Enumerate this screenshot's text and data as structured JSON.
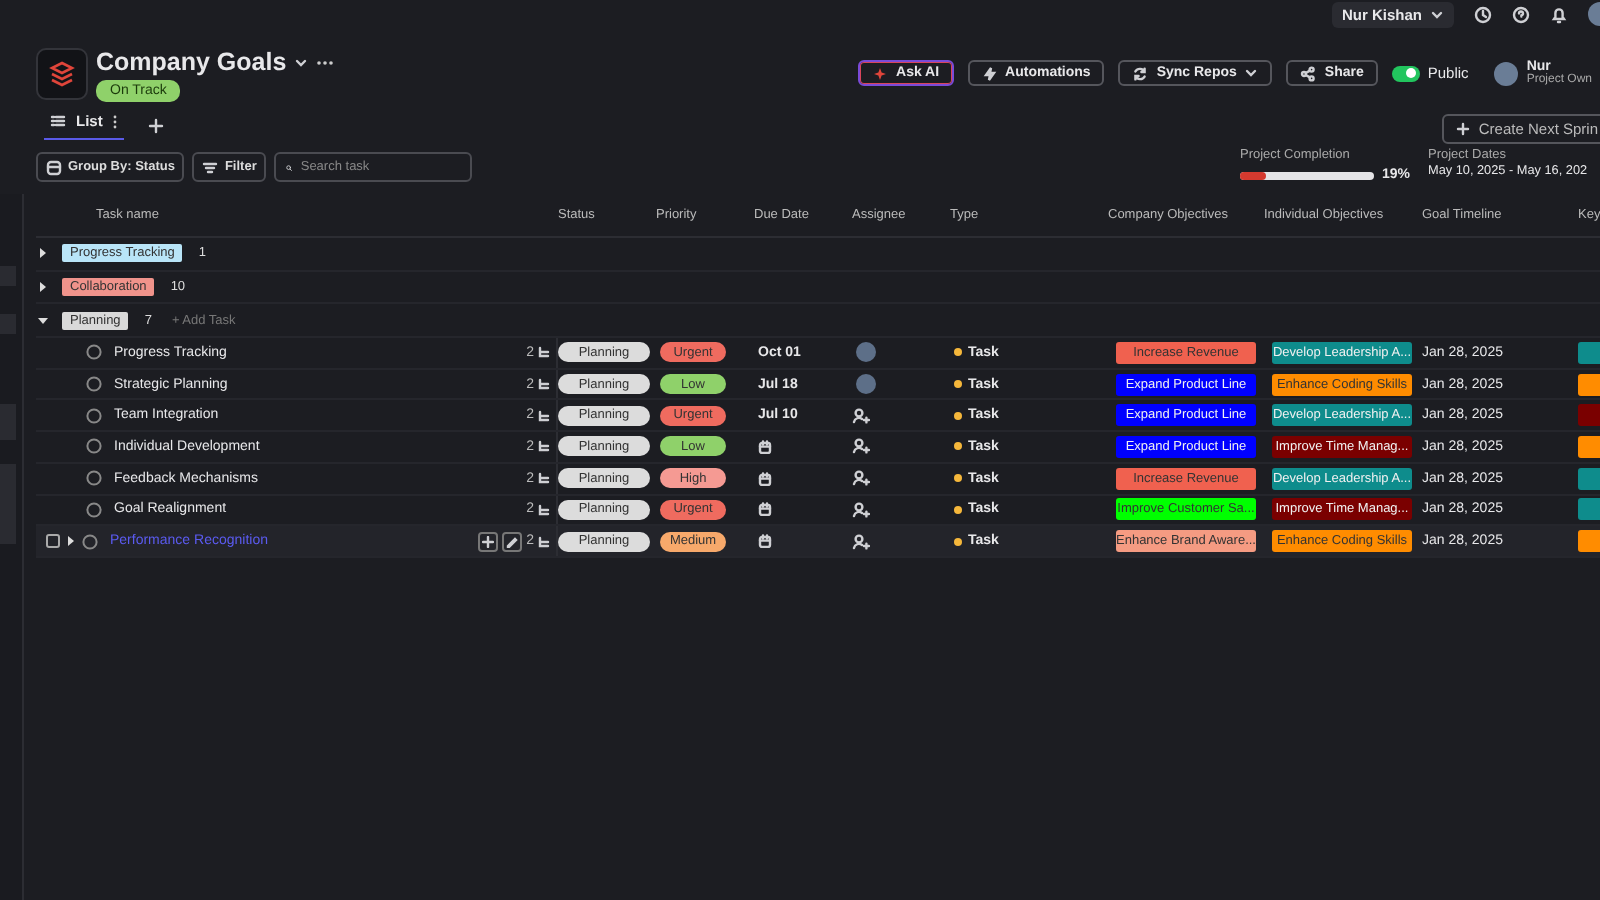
{
  "top_bar": {
    "user": "Nur Kishan"
  },
  "project": {
    "title": "Company Goals",
    "status": "On Track"
  },
  "actions": [
    {
      "kind": "ai",
      "label": "Ask AI"
    },
    {
      "kind": "bolt",
      "label": "Automations"
    },
    {
      "kind": "sync",
      "label": "Sync Repos"
    },
    {
      "kind": "share",
      "label": "Share"
    }
  ],
  "visibility": {
    "label": "Public",
    "on": true
  },
  "owner": {
    "name": "Nur",
    "role": "Project Own"
  },
  "tabs": [
    {
      "label": "List",
      "selected": true
    }
  ],
  "create_button": "Create Next Sprin",
  "toolbar": {
    "group_by": "Group By: Status",
    "filter": "Filter",
    "search_placeholder": "Search task"
  },
  "completion": {
    "label": "Project Completion",
    "level": 0.19,
    "reading": "19%"
  },
  "dates": {
    "label": "Project Dates",
    "value": "May 10, 2025 - May 16, 202"
  },
  "table": {
    "columns": [
      "Task name",
      "Status",
      "Priority",
      "Due Date",
      "Assignee",
      "Type",
      "Company Objectives",
      "Individual Objectives",
      "Goal Timeline",
      "Key"
    ],
    "groups": [
      {
        "label": "Progress Tracking",
        "color": "#b9e5f8",
        "count": "1",
        "expanded": false
      },
      {
        "label": "Collaboration",
        "color": "#f0938b",
        "count": "10",
        "expanded": false
      },
      {
        "label": "Planning",
        "color": "#d9d9d9",
        "count": "7",
        "expanded": true,
        "add_label": "+ Add Task",
        "rows": [
          {
            "name": "Progress Tracking",
            "comments": "2",
            "status": "Planning",
            "priority": {
              "label": "Urgent",
              "color": "#ef6b5f"
            },
            "due": "Oct 01",
            "assigned": true,
            "type": "Task",
            "company": {
              "label": "Increase Revenue",
              "color": "#f0614f"
            },
            "individual": {
              "label": "Develop Leadership A...",
              "color": "#0e8c8c"
            },
            "timeline": "Jan 28, 2025",
            "key": {
              "color": "#0e8c8c"
            },
            "hovered": false
          },
          {
            "name": "Strategic Planning",
            "comments": "2",
            "status": "Planning",
            "priority": {
              "label": "Low",
              "color": "#8fd16a"
            },
            "due": "Jul 18",
            "assigned": true,
            "type": "Task",
            "company": {
              "label": "Expand Product Line",
              "color": "#0000ff"
            },
            "individual": {
              "label": "Enhance Coding Skills",
              "color": "#ff8c00"
            },
            "timeline": "Jan 28, 2025",
            "key": {
              "color": "#ff8c00"
            },
            "hovered": false
          },
          {
            "name": "Team Integration",
            "comments": "2",
            "status": "Planning",
            "priority": {
              "label": "Urgent",
              "color": "#ef6b5f"
            },
            "due": "Jul 10",
            "assigned": false,
            "type": "Task",
            "company": {
              "label": "Expand Product Line",
              "color": "#0000ff"
            },
            "individual": {
              "label": "Develop Leadership A...",
              "color": "#0e8c8c"
            },
            "timeline": "Jan 28, 2025",
            "key": {
              "color": "#7a0000"
            },
            "hovered": false
          },
          {
            "name": "Individual Development",
            "comments": "2",
            "status": "Planning",
            "priority": {
              "label": "Low",
              "color": "#8fd16a"
            },
            "assigned": false,
            "type": "Task",
            "company": {
              "label": "Expand Product Line",
              "color": "#0000ff"
            },
            "individual": {
              "label": "Improve Time Manag...",
              "color": "#7a0000"
            },
            "timeline": "Jan 28, 2025",
            "key": {
              "color": "#ff8c00"
            },
            "hovered": false
          },
          {
            "name": "Feedback Mechanisms",
            "comments": "2",
            "status": "Planning",
            "priority": {
              "label": "High",
              "color": "#f59a93"
            },
            "assigned": false,
            "type": "Task",
            "company": {
              "label": "Increase Revenue",
              "color": "#f0614f"
            },
            "individual": {
              "label": "Develop Leadership A...",
              "color": "#0e8c8c"
            },
            "timeline": "Jan 28, 2025",
            "key": {
              "color": "#0e8c8c"
            },
            "hovered": false
          },
          {
            "name": "Goal Realignment",
            "comments": "2",
            "status": "Planning",
            "priority": {
              "label": "Urgent",
              "color": "#ef6b5f"
            },
            "assigned": false,
            "type": "Task",
            "company": {
              "label": "Improve Customer Sa...",
              "color": "#00ff00"
            },
            "individual": {
              "label": "Improve Time Manag...",
              "color": "#7a0000"
            },
            "timeline": "Jan 28, 2025",
            "key": {
              "color": "#0e8c8c"
            },
            "hovered": false
          },
          {
            "name": "Performance Recognition",
            "comments": "2",
            "status": "Planning",
            "priority": {
              "label": "Medium",
              "color": "#f7a96b"
            },
            "assigned": false,
            "type": "Task",
            "company": {
              "label": "Enhance Brand Aware...",
              "color": "#f59b82"
            },
            "individual": {
              "label": "Enhance Coding Skills",
              "color": "#ff8c00"
            },
            "timeline": "Jan 28, 2025",
            "key": {
              "color": "#ff8c00"
            },
            "hovered": true
          }
        ]
      }
    ]
  }
}
